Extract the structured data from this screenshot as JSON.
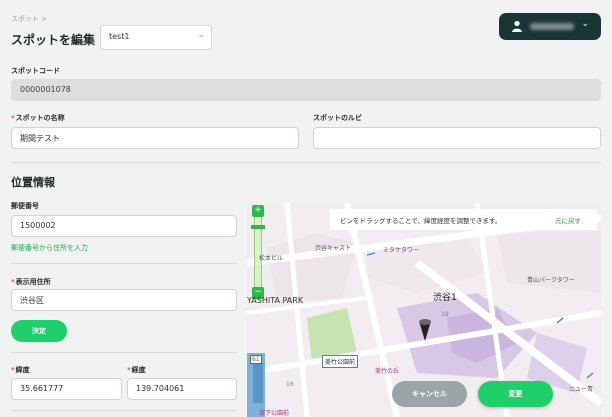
{
  "breadcrumb": "スポット >",
  "page_title": "スポットを編集",
  "selector": {
    "value": "test1"
  },
  "user_menu": {
    "chevron": "⌄"
  },
  "spot_code": {
    "label": "スポットコード",
    "value": "0000001078"
  },
  "spot_name": {
    "required_mark": "*",
    "label": "スポットの名称",
    "value": "期間テスト"
  },
  "spot_ruby": {
    "label": "スポットのルビ",
    "value": ""
  },
  "location": {
    "section_title": "位置情報",
    "postal": {
      "label": "郵便番号",
      "value": "1500002",
      "lookup_link": "郵便番号から住所を入力"
    },
    "address": {
      "required_mark": "*",
      "label": "表示用住所",
      "value": "渋谷区",
      "confirm_label": "決定"
    },
    "latitude": {
      "required_mark": "*",
      "label": "緯度",
      "value": "35.661777"
    },
    "longitude": {
      "required_mark": "*",
      "label": "経度",
      "value": "139.704061"
    }
  },
  "map": {
    "notice": "ピンをドラッグすることで、緯度経度を調整できます。",
    "reset_label": "元に戻す",
    "zoom_plus": "+",
    "zoom_minus": "−",
    "place_labels": {
      "shibuya_cast": "渋谷キャスト",
      "matsumoto_bldg": "松本ビル",
      "mitake_tower": "ミタケタワー",
      "miyashita_park": "YASHITA PARK",
      "aoyama_park_tower": "青山パークタワー",
      "shibuya1": "渋谷1",
      "block18": "18",
      "block16": "16",
      "mitake_park": "美竹公園前",
      "mitake_hill": "美竹の丘",
      "miyashita_park_front": "宮下公園前",
      "new_ma": "ニュー青",
      "route61": "61"
    }
  },
  "actions": {
    "cancel": "キャンセル",
    "change": "変更"
  },
  "colors": {
    "accent": "#1fd06a",
    "dark": "#1a3535",
    "required": "#e24b4b",
    "link": "#22a84b"
  }
}
